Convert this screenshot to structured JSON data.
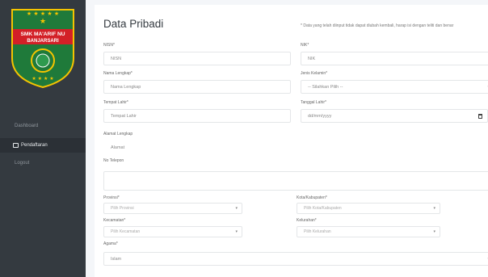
{
  "logo": {
    "line1": "SMK MA'ARIF NU",
    "line2": "BANJARSARI"
  },
  "sidebar": {
    "items": [
      {
        "label": "Dashboard"
      },
      {
        "label": "Pendaftaran"
      },
      {
        "label": "Logout"
      }
    ]
  },
  "header": {
    "title": "Data Pribadi",
    "note": "* Data yang telah diinput tidak dapat diubah kembali, harap isi dengan teliti dan benar"
  },
  "form": {
    "nisn": {
      "label": "NISN*",
      "placeholder": "NISN"
    },
    "nik": {
      "label": "NIK*",
      "placeholder": "NIK"
    },
    "nama": {
      "label": "Nama Lengkap*",
      "placeholder": "Nama Lengkap"
    },
    "jenis_kelamin": {
      "label": "Jenis Kelamin*",
      "value": "-- Silahkan Pilih --"
    },
    "tempat_lahir": {
      "label": "Tempat Lahir*",
      "placeholder": "Tempat Lahir"
    },
    "tanggal_lahir": {
      "label": "Tanggal Lahir*",
      "value": "dd/mm/yyyy"
    },
    "alamat": {
      "label": "Alamat Lengkap",
      "placeholder": "Alamat"
    },
    "telepon": {
      "label": "No Telepon"
    },
    "provinsi": {
      "label": "Provinsi*",
      "value": "Pilih Provinsi"
    },
    "kota": {
      "label": "Kota/Kabupaten*",
      "value": "Pilih Kota/Kabupaten"
    },
    "kecamatan": {
      "label": "Kecamatan*",
      "value": "Pilih Kecamatan"
    },
    "kelurahan": {
      "label": "Kelurahan*",
      "value": "Pilih Kelurahan"
    },
    "agama": {
      "label": "Agama*",
      "value": "Islam"
    }
  },
  "colors": {
    "sidebar": "#343a40",
    "logo_red": "#d32027",
    "logo_green": "#1f7a3a",
    "logo_gold": "#f5c400"
  }
}
